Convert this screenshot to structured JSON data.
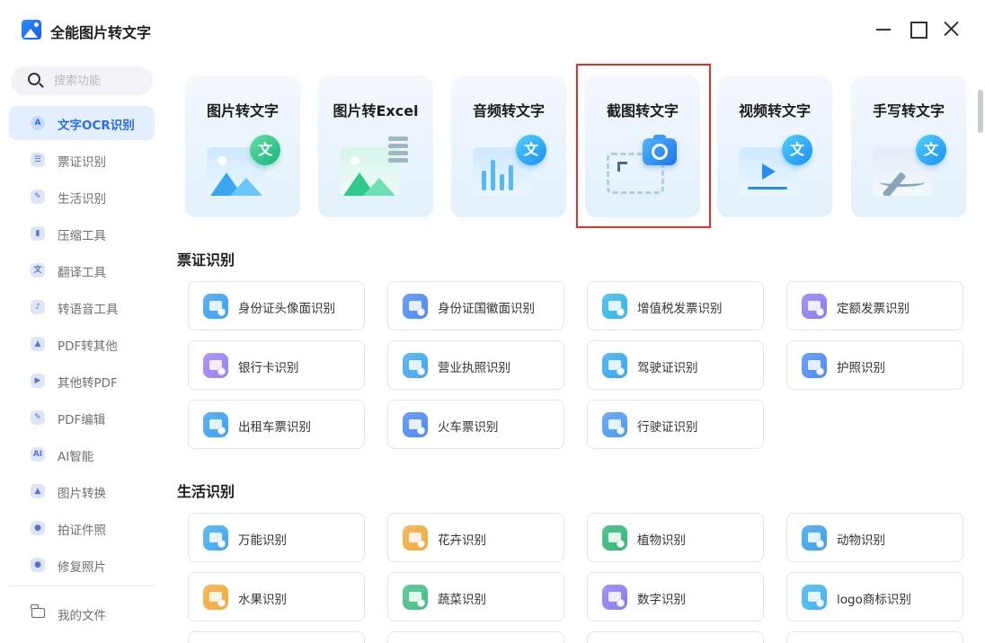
{
  "app": {
    "title": "全能图片转文字"
  },
  "sidebar": {
    "search_placeholder": "搜索功能",
    "items": [
      {
        "label": "文字OCR识别",
        "icon": "ocr-icon",
        "icon_text": "A",
        "active": true
      },
      {
        "label": "票证识别",
        "icon": "ticket-icon",
        "icon_text": "☰"
      },
      {
        "label": "生活识别",
        "icon": "leaf-icon",
        "icon_text": "✎"
      },
      {
        "label": "压缩工具",
        "icon": "compress-icon",
        "icon_text": "▮"
      },
      {
        "label": "翻译工具",
        "icon": "translate-icon",
        "icon_text": "文"
      },
      {
        "label": "转语音工具",
        "icon": "audio-icon",
        "icon_text": "♪"
      },
      {
        "label": "PDF转其他",
        "icon": "pdf-export-icon",
        "icon_text": "▲"
      },
      {
        "label": "其他转PDF",
        "icon": "pdf-import-icon",
        "icon_text": "▶"
      },
      {
        "label": "PDF编辑",
        "icon": "pdf-edit-icon",
        "icon_text": "✎"
      },
      {
        "label": "AI智能",
        "icon": "ai-icon",
        "icon_text": "AI"
      },
      {
        "label": "图片转换",
        "icon": "image-convert-icon",
        "icon_text": "▲"
      },
      {
        "label": "拍证件照",
        "icon": "id-photo-icon",
        "icon_text": "●"
      },
      {
        "label": "修复照片",
        "icon": "repair-photo-icon",
        "icon_text": "●"
      }
    ],
    "files_label": "我的文件"
  },
  "features": [
    {
      "title": "图片转文字",
      "art": "image-text"
    },
    {
      "title": "图片转Excel",
      "art": "image-excel"
    },
    {
      "title": "音频转文字",
      "art": "audio-text"
    },
    {
      "title": "截图转文字",
      "art": "screenshot-text",
      "selected": true
    },
    {
      "title": "视频转文字",
      "art": "video-text"
    },
    {
      "title": "手写转文字",
      "art": "handwriting-text"
    }
  ],
  "art_glyph": "文",
  "sections": [
    {
      "title": "票证识别",
      "tools": [
        {
          "label": "身份证头像面识别",
          "color": "#3aa0f0"
        },
        {
          "label": "身份证国徽面识别",
          "color": "#4b8af5"
        },
        {
          "label": "增值税发票识别",
          "color": "#33b6e8"
        },
        {
          "label": "定额发票识别",
          "color": "#8a7cf0"
        },
        {
          "label": "银行卡识别",
          "color": "#9c7ef2"
        },
        {
          "label": "营业执照识别",
          "color": "#3fa8f0"
        },
        {
          "label": "驾驶证识别",
          "color": "#38a6f0"
        },
        {
          "label": "护照识别",
          "color": "#4b8af5"
        },
        {
          "label": "出租车票识别",
          "color": "#3aa0f0"
        },
        {
          "label": "火车票识别",
          "color": "#4b8af5"
        },
        {
          "label": "行驶证识别",
          "color": "#4a9af3"
        }
      ]
    },
    {
      "title": "生活识别",
      "tools": [
        {
          "label": "万能识别",
          "color": "#3fa8f0"
        },
        {
          "label": "花卉识别",
          "color": "#f3a93a"
        },
        {
          "label": "植物识别",
          "color": "#2fb67a"
        },
        {
          "label": "动物识别",
          "color": "#3aa0f0"
        },
        {
          "label": "水果识别",
          "color": "#f3a93a"
        },
        {
          "label": "蔬菜识别",
          "color": "#3fbf86"
        },
        {
          "label": "数字识别",
          "color": "#8a7cf0"
        },
        {
          "label": "logo商标识别",
          "color": "#3fb3f0"
        }
      ]
    }
  ]
}
